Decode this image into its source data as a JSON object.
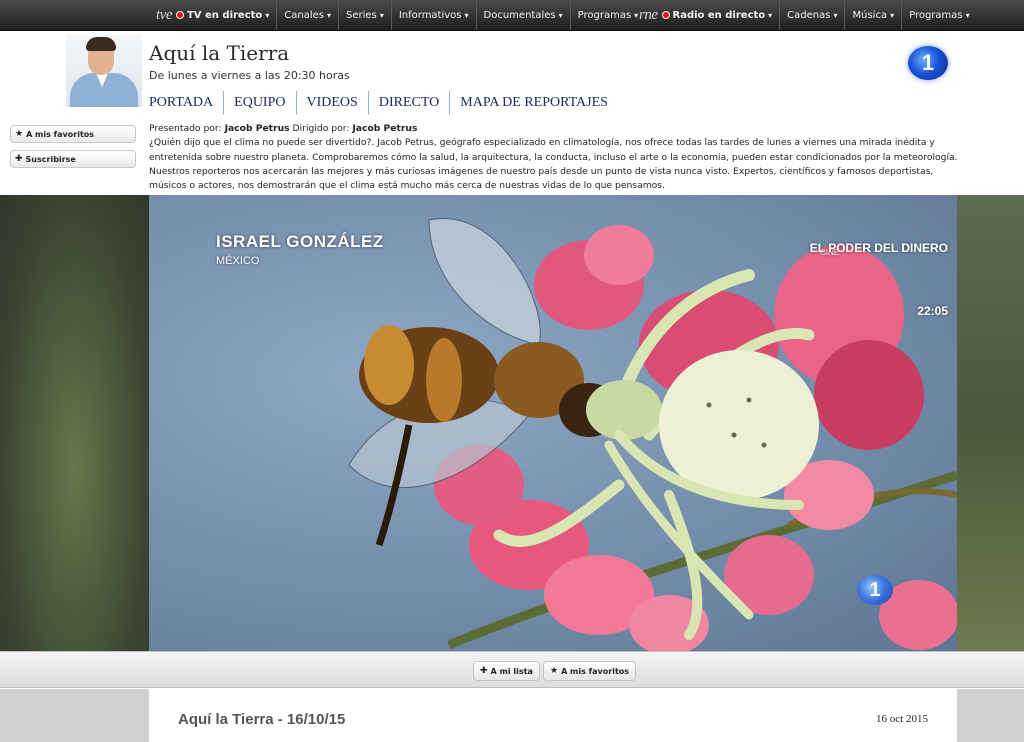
{
  "topnav": {
    "tve": {
      "brand": "tve",
      "live_label": "TV en directo",
      "items": [
        {
          "label": "Canales"
        },
        {
          "label": "Series"
        },
        {
          "label": "Informativos"
        },
        {
          "label": "Documentales"
        },
        {
          "label": "Programas"
        }
      ]
    },
    "rne": {
      "brand": "rne",
      "live_label": "Radio en directo",
      "items": [
        {
          "label": "Cadenas"
        },
        {
          "label": "Música"
        },
        {
          "label": "Programas"
        }
      ]
    },
    "caret": "▾"
  },
  "header": {
    "title": "Aquí la Tierra",
    "schedule": "De lunes a viernes a las 20:30 horas",
    "channel_logo": "1",
    "subnav": [
      {
        "label": "PORTADA"
      },
      {
        "label": "EQUIPO"
      },
      {
        "label": "VIDEOS"
      },
      {
        "label": "DIRECTO"
      },
      {
        "label": "MAPA DE REPORTAJES"
      }
    ]
  },
  "side_buttons": {
    "favorites": {
      "icon": "star-icon",
      "glyph": "★",
      "label": "A mis favoritos"
    },
    "subscribe": {
      "icon": "plus-icon",
      "glyph": "✚",
      "label": "Suscribirse"
    }
  },
  "info": {
    "presented_prefix": "Presentado por:",
    "presenter": "Jacob Petrus",
    "directed_prefix": "Dirigido por:",
    "director": "Jacob Petrus",
    "description": "¿Quién dijo que el clima no puede ser divertido?. Jacob Petrus, geógrafo especializado en climatología, nos ofrece todas las tardes de lunes a viernes una mirada inédita y entretenida sobre nuestro planeta. Comprobaremos cómo la salud, la arquitectura, la conducta, incluso el arte o la economía, pueden estar condicionados por la meteorología. Nuestros reporteros nos acercarán las mejores y más curiosas imágenes de nuestro país desde un punto de vista nunca visto. Expertos, científicos y famosos deportistas, músicos o actores, nos demostrarán que el clima está mucho más cerca de nuestras vidas de lo que pensamos."
  },
  "video": {
    "overlay_name": "ISRAEL GONZÁLEZ",
    "overlay_country": "MÉXICO",
    "overlay_cine": "CINE",
    "overlay_film": "EL PODER DEL DINERO",
    "overlay_time": "22:05",
    "overlay_logo": "1"
  },
  "toolbar": {
    "add_list": {
      "icon": "plus-icon",
      "glyph": "✚",
      "label": "A mi lista"
    },
    "add_fav": {
      "icon": "star-icon",
      "glyph": "★",
      "label": "A mis favoritos"
    }
  },
  "episode": {
    "title": "Aquí la Tierra - 16/10/15",
    "date": "16 oct 2015"
  },
  "colors": {
    "nav_bg": "#2e2e2e",
    "live_dot": "#e01010",
    "subnav_text": "#1a2a55",
    "channel_blue": "#1a54d8"
  }
}
